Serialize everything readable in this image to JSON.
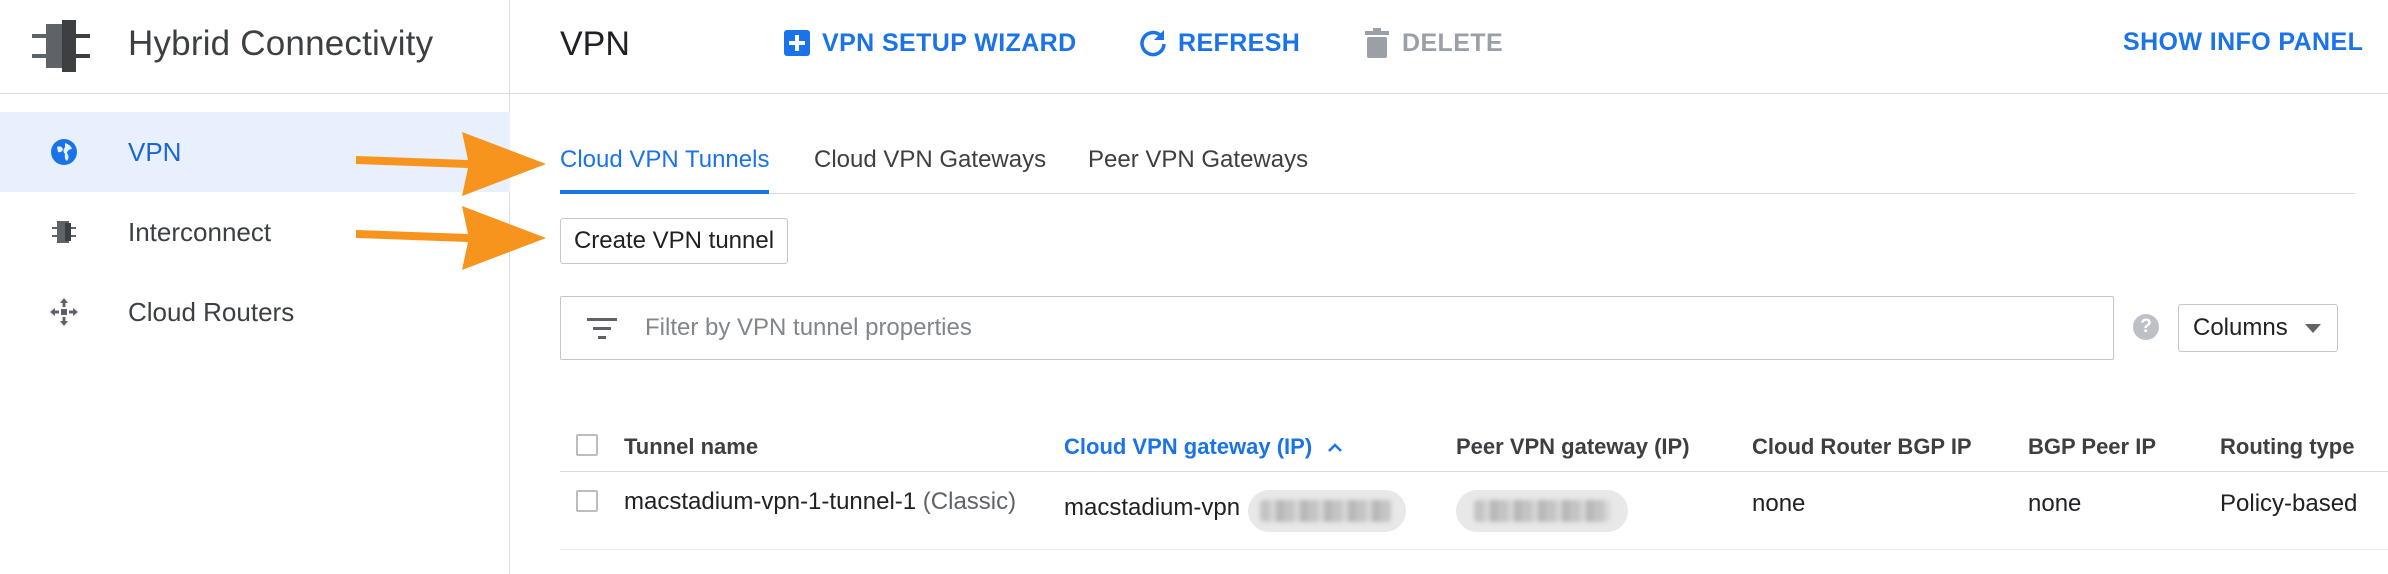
{
  "sidebar": {
    "title": "Hybrid Connectivity",
    "items": [
      {
        "label": "VPN",
        "icon": "globe-icon",
        "active": true
      },
      {
        "label": "Interconnect",
        "icon": "interconnect-icon",
        "active": false
      },
      {
        "label": "Cloud Routers",
        "icon": "cloud-routers-icon",
        "active": false
      }
    ]
  },
  "topbar": {
    "page_title": "VPN",
    "wizard_label": "VPN SETUP WIZARD",
    "refresh_label": "REFRESH",
    "delete_label": "DELETE",
    "info_panel_label": "SHOW INFO PANEL"
  },
  "tabs": [
    {
      "label": "Cloud VPN Tunnels",
      "active": true
    },
    {
      "label": "Cloud VPN Gateways",
      "active": false
    },
    {
      "label": "Peer VPN Gateways",
      "active": false
    }
  ],
  "create_button": "Create VPN tunnel",
  "filter": {
    "placeholder": "Filter by VPN tunnel properties",
    "columns_label": "Columns",
    "help_symbol": "?"
  },
  "table": {
    "headers": {
      "tunnel_name": "Tunnel name",
      "cloud_gateway": "Cloud VPN gateway (IP)",
      "peer_gateway": "Peer VPN gateway (IP)",
      "router_bgp_ip": "Cloud Router BGP IP",
      "bgp_peer_ip": "BGP Peer IP",
      "routing_type": "Routing type"
    },
    "rows": [
      {
        "tunnel_name": "macstadium-vpn-1-tunnel-1",
        "tunnel_suffix": "(Classic)",
        "cloud_gateway": "macstadium-vpn",
        "router_bgp_ip": "none",
        "bgp_peer_ip": "none",
        "routing_type": "Policy-based"
      }
    ]
  },
  "colors": {
    "accent": "#1a73e8",
    "active_nav_bg": "#e8f0fe",
    "arrow": "#f7941d",
    "disabled": "#9aa0a6"
  }
}
